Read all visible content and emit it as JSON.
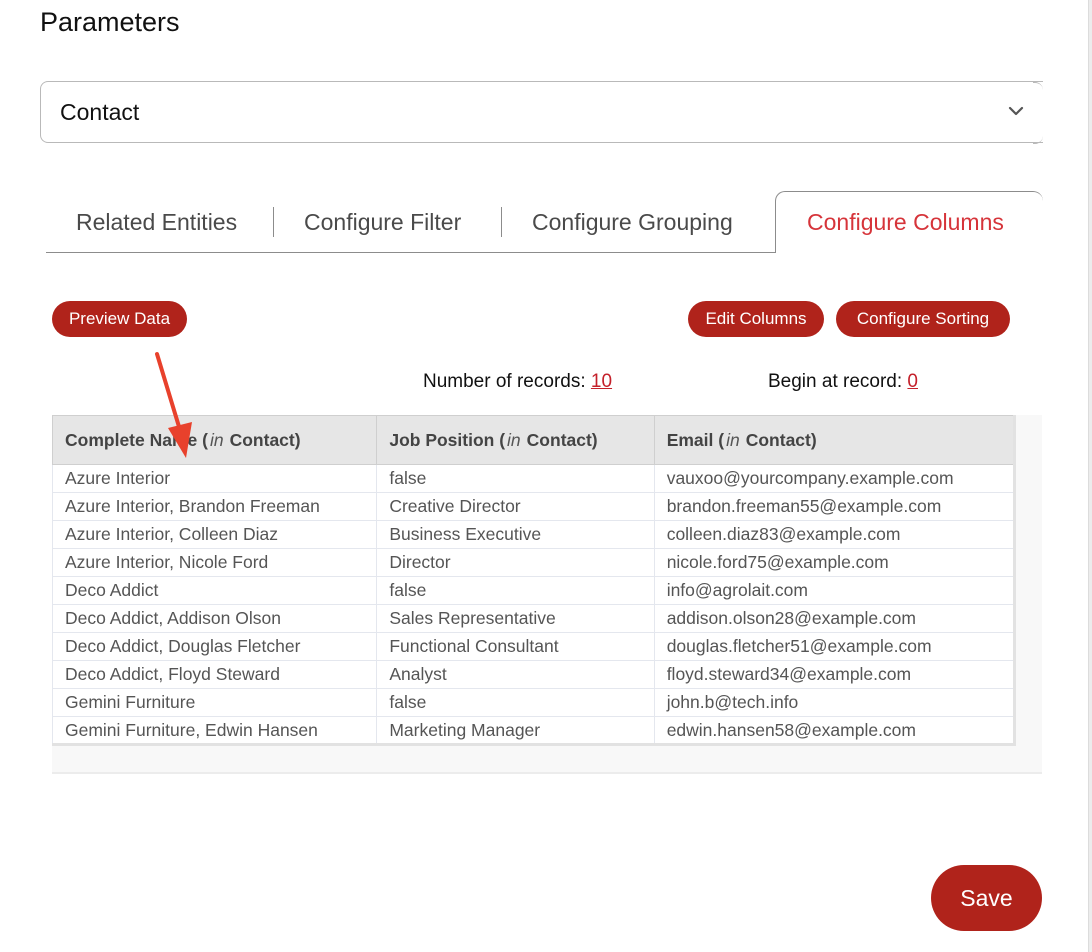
{
  "page": {
    "title": "Parameters"
  },
  "model_select": {
    "value": "Contact",
    "icon": "chevron-down-icon"
  },
  "tabs": [
    {
      "label": "Related Entities",
      "active": false
    },
    {
      "label": "Configure Filter",
      "active": false
    },
    {
      "label": "Configure Grouping",
      "active": false
    },
    {
      "label": "Configure Columns",
      "active": true
    }
  ],
  "toolbar": {
    "preview_label": "Preview Data",
    "edit_columns_label": "Edit Columns",
    "configure_sorting_label": "Configure Sorting"
  },
  "records": {
    "count_label": "Number of records:",
    "count_value": "10",
    "begin_label": "Begin at record:",
    "begin_value": "0"
  },
  "table": {
    "columns": [
      {
        "name": "Complete Name",
        "in": "in",
        "model": "Contact)"
      },
      {
        "name": "Job Position",
        "in": "in",
        "model": "Contact)"
      },
      {
        "name": "Email",
        "in": "in",
        "model": "Contact)"
      }
    ],
    "rows": [
      [
        "Azure Interior",
        "false",
        "vauxoo@yourcompany.example.com"
      ],
      [
        "Azure Interior, Brandon Freeman",
        "Creative Director",
        "brandon.freeman55@example.com"
      ],
      [
        "Azure Interior, Colleen Diaz",
        "Business Executive",
        "colleen.diaz83@example.com"
      ],
      [
        "Azure Interior, Nicole Ford",
        "Director",
        "nicole.ford75@example.com"
      ],
      [
        "Deco Addict",
        "false",
        "info@agrolait.com"
      ],
      [
        "Deco Addict, Addison Olson",
        "Sales Representative",
        "addison.olson28@example.com"
      ],
      [
        "Deco Addict, Douglas Fletcher",
        "Functional Consultant",
        "douglas.fletcher51@example.com"
      ],
      [
        "Deco Addict, Floyd Steward",
        "Analyst",
        "floyd.steward34@example.com"
      ],
      [
        "Gemini Furniture",
        "false",
        "john.b@tech.info"
      ],
      [
        "Gemini Furniture, Edwin Hansen",
        "Marketing Manager",
        "edwin.hansen58@example.com"
      ]
    ]
  },
  "annotation": {
    "icon": "red-arrow-annotation",
    "color": "#e8412c"
  },
  "footer": {
    "save_label": "Save"
  },
  "colors": {
    "accent": "#b0231b",
    "active_tab": "#d6343a",
    "link": "#c4202a"
  }
}
